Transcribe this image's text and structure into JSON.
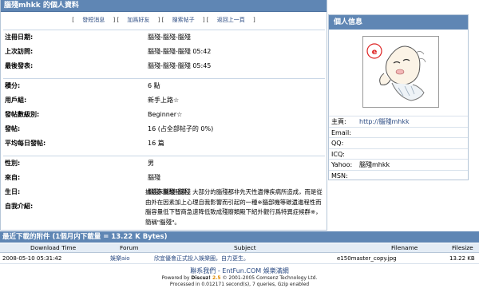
{
  "header": {
    "title": "腦殘mhkk 的個人資料"
  },
  "links": [
    {
      "label": "發短消息"
    },
    {
      "label": "加爲好友"
    },
    {
      "label": "搜索帖子"
    },
    {
      "label": "返回上一頁"
    }
  ],
  "info": {
    "reg_label": "注冊日期:",
    "reg_value": "腦殘-腦殘-腦殘",
    "visit_label": "上次訪問:",
    "visit_value": "腦殘-腦殘-腦殘 05:42",
    "post_label": "最後發表:",
    "post_value": "腦殘-腦殘-腦殘 05:45",
    "credits_label": "積分:",
    "credits_value": "6 點",
    "group_label": "用戶組:",
    "group_value": "新手上路☆",
    "level_label": "發帖數級別:",
    "level_value": "Beginner☆",
    "posts_label": "發帖:",
    "posts_value": "16 (占全部帖子的 0%)",
    "avg_label": "平均每日發帖:",
    "avg_value": "16 篇",
    "gender_label": "性別:",
    "gender_value": "男",
    "from_label": "來自:",
    "from_value": "腦殘",
    "birth_label": "生日:",
    "birth_value": "腦殘-腦殘-腦殘",
    "intro_label": "自我介紹:",
    "intro_value": "據臨床實驗發現，大部分的腦殘都非先天性遺傳疾病所造成，而是從由外在因素加上心理自我影響而引起的一種※腦部機等碳遺進程性而腦容量低下智商急速降低致成殘廢類殿下紹外觀行爲特異症候群※，簡稱\"腦殘\"。"
  },
  "side": {
    "title": "個人信息",
    "homepage_label": "主頁:",
    "homepage_value": "http://腦殘mhkk",
    "email_label": "Email:",
    "email_value": "",
    "qq_label": "QQ:",
    "qq_value": "",
    "icq_label": "ICQ:",
    "icq_value": "",
    "yahoo_label": "Yahoo:",
    "yahoo_value": "腦殘mhkk",
    "msn_label": "MSN:",
    "msn_value": ""
  },
  "downloads": {
    "title": "最近下載的附件 (1個月内下載量 = 13.22 K Bytes)",
    "columns": {
      "time": "Download Time",
      "forum": "Forum",
      "subject": "Subject",
      "filename": "Filename",
      "filesize": "Filesize"
    },
    "rows": [
      {
        "time": "2008-05-10 05:31:42",
        "forum": "娛樂aio",
        "subject": "欣宜優會正式投入娛樂圈，自力更生。",
        "filename": "e150master_copy.jpg",
        "filesize": "13.22 KB"
      }
    ]
  },
  "footer": {
    "contact": "聯系我們",
    "site": "EntFun.COM 娛樂滿網",
    "powered_prefix": "Powered by ",
    "powered_name": "Discuz!",
    "powered_version": "2.5",
    "copyright": "© 2001-2005 Comsenz Technology Ltd.",
    "stats": "Processed in 0.012171 second(s), 7 queries, Gzip enabled"
  }
}
